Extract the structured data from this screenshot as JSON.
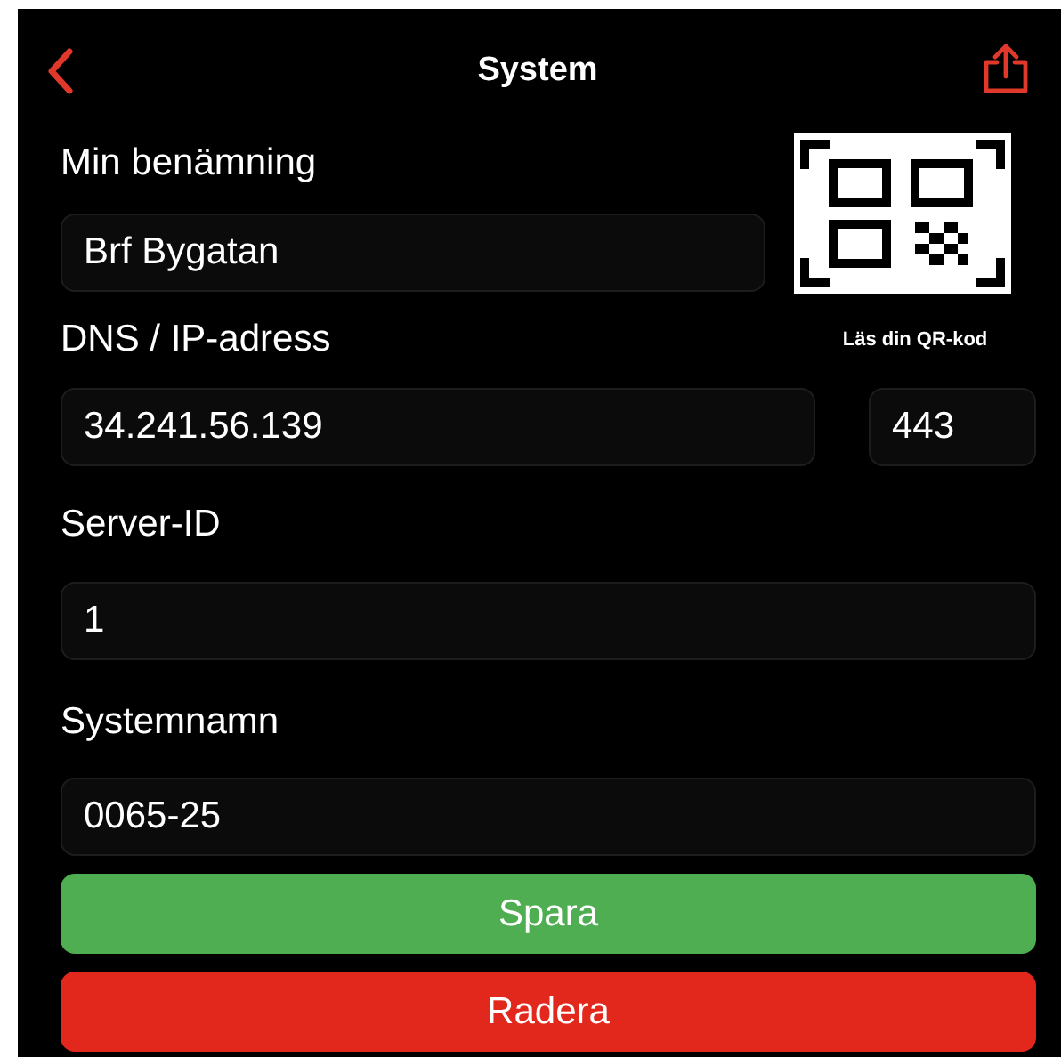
{
  "header": {
    "title": "System"
  },
  "name_field": {
    "label": "Min benämning",
    "value": "Brf Bygatan"
  },
  "qr": {
    "caption": "Läs din QR-kod"
  },
  "address": {
    "label": "DNS / IP-adress",
    "host": "34.241.56.139",
    "port": "443"
  },
  "server_id": {
    "label": "Server-ID",
    "value": "1"
  },
  "system_name": {
    "label": "Systemnamn",
    "value": "0065-25"
  },
  "buttons": [
    {
      "label": "Spara",
      "kind": "save"
    },
    {
      "label": "Radera",
      "kind": "delete"
    }
  ]
}
